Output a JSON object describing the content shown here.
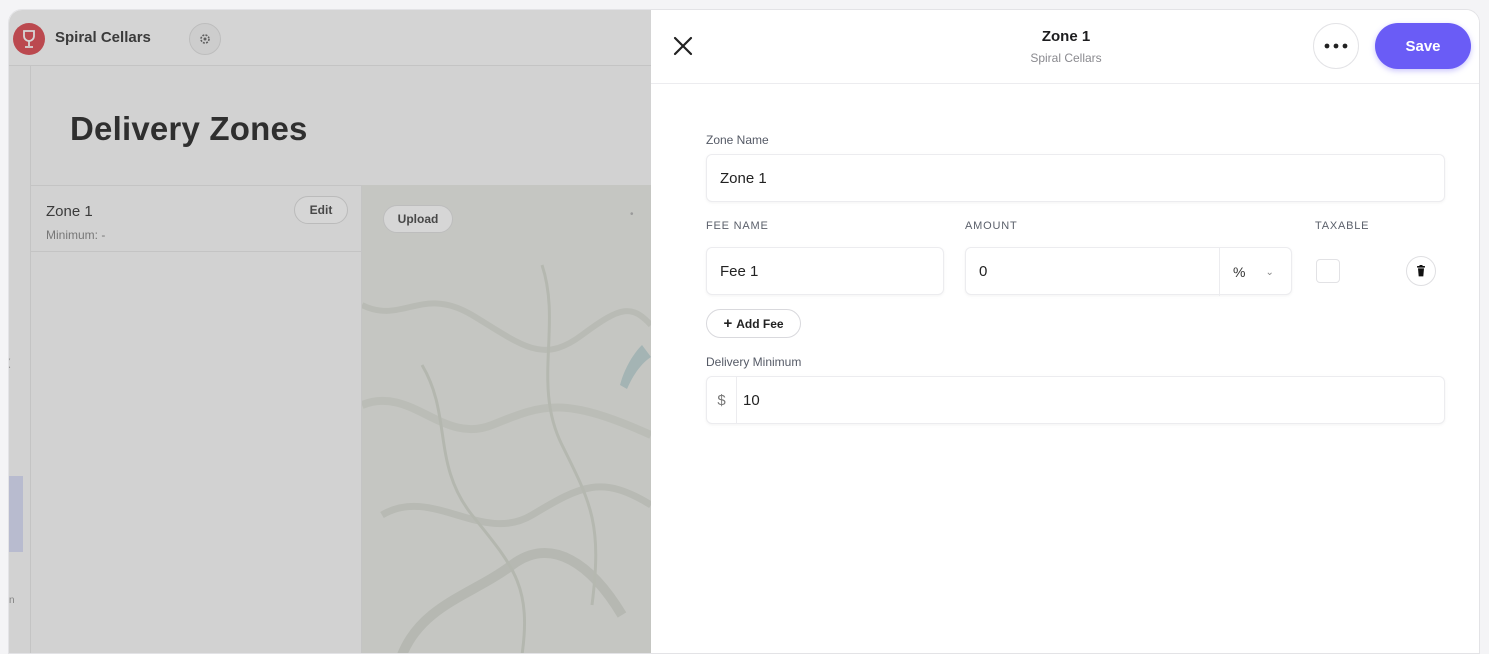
{
  "app": {
    "brand_name": "Spiral Cellars",
    "page_title": "Delivery Zones",
    "rail_text_top": "(",
    "rail_text_bottom": "n"
  },
  "zones_list": {
    "items": [
      {
        "name": "Zone 1",
        "minimum": "Minimum: -",
        "edit_label": "Edit"
      }
    ]
  },
  "map": {
    "upload_label": "Upload"
  },
  "drawer": {
    "title": "Zone 1",
    "subtitle": "Spiral Cellars",
    "more_label": "•••",
    "save_label": "Save",
    "accent_color": "#6a5cf6",
    "zone_name": {
      "label": "Zone Name",
      "value": "Zone 1"
    },
    "fees": {
      "columns": {
        "fee_name": "FEE NAME",
        "amount": "AMOUNT",
        "taxable": "TAXABLE"
      },
      "rows": [
        {
          "fee_name": "Fee 1",
          "amount": "0",
          "unit": "%",
          "taxable": false
        }
      ],
      "add_label": "Add Fee"
    },
    "delivery_minimum": {
      "label": "Delivery Minimum",
      "currency": "$",
      "value": "10"
    }
  },
  "icons": {
    "close": "close-icon",
    "settings": "gear-icon",
    "more": "more-icon",
    "trash": "trash-icon",
    "chevron": "chevron-down-icon",
    "brand": "wine-glass-icon"
  }
}
